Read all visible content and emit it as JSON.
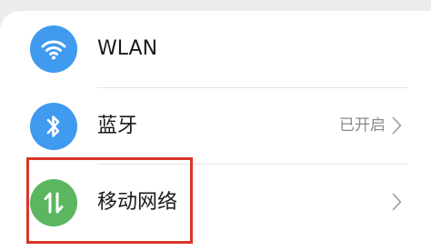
{
  "settings": {
    "items": [
      {
        "label": "WLAN",
        "status": "",
        "icon": "wifi-icon",
        "icon_color": "#3f9af0"
      },
      {
        "label": "蓝牙",
        "status": "已开启",
        "icon": "bluetooth-icon",
        "icon_color": "#3f9af0"
      },
      {
        "label": "移动网络",
        "status": "",
        "icon": "mobile-data-icon",
        "icon_color": "#5bb65f"
      }
    ]
  },
  "annotation": {
    "highlight_color": "#d9352b"
  }
}
